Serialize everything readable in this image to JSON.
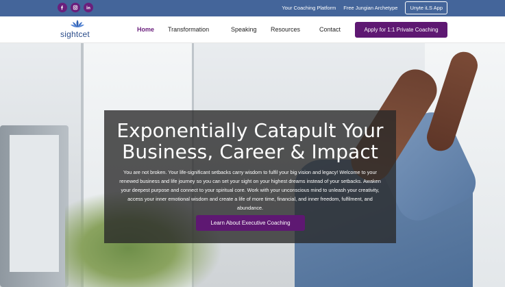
{
  "topbar": {
    "social": [
      {
        "name": "facebook-icon",
        "glyph": "f"
      },
      {
        "name": "instagram-icon",
        "glyph": "◎"
      },
      {
        "name": "linkedin-icon",
        "glyph": "in"
      }
    ],
    "links": [
      "Your Coaching Platform",
      "Free Jungian Archetype"
    ],
    "app_button": "Unyte iLS App"
  },
  "nav": {
    "logo_text": "sightcet",
    "items": [
      "Home",
      "Transformation",
      "Speaking",
      "Resources",
      "Contact"
    ],
    "active_index": 0,
    "cta": "Apply for 1:1 Private Coaching"
  },
  "hero": {
    "title_line1": "Exponentially Catapult Your",
    "title_line2": "Business, Career & Impact",
    "body": "You are not broken. Your life-significant setbacks carry wisdom to fulfil your big vision and legacy! Welcome to your renewed business and life journey so you can set your sight on your highest dreams instead of your setbacks. Awaken your deepest purpose and connect to your spiritual core. Work with your unconscious mind to unleash your creativity, access your inner emotional wisdom and create a life of more time, financial, and inner freedom, fulfilment, and abundance.",
    "cta": "Learn About Executive Coaching"
  },
  "colors": {
    "topbar": "#44659a",
    "brand_purple": "#5e1872",
    "active_nav": "#6a1f7c"
  }
}
